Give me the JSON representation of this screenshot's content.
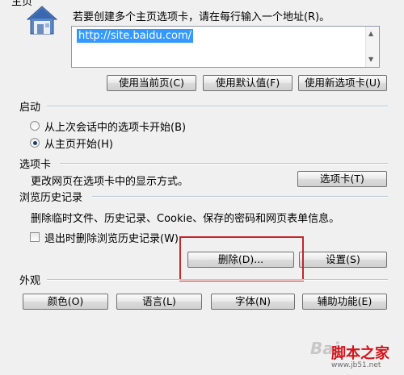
{
  "homepage": {
    "section_title": "主页",
    "instruction": "若要创建多个主页选项卡，请在每行输入一个地址(R)。",
    "url_value": "http://site.baidu.com/",
    "use_current_label": "使用当前页(C)",
    "use_default_label": "使用默认值(F)",
    "use_new_tab_label": "使用新选项卡(U)"
  },
  "startup": {
    "section_title": "启动",
    "option_last_session": "从上次会话中的选项卡开始(B)",
    "option_homepage": "从主页开始(H)",
    "selected": "option_homepage"
  },
  "tabs": {
    "section_title": "选项卡",
    "description": "更改网页在选项卡中的显示方式。",
    "tabs_button_label": "选项卡(T)"
  },
  "history": {
    "section_title": "浏览历史记录",
    "description": "删除临时文件、历史记录、Cookie、保存的密码和网页表单信息。",
    "delete_on_exit_label": "退出时删除浏览历史记录(W)",
    "delete_on_exit_checked": false,
    "delete_button_label": "删除(D)...",
    "settings_button_label": "设置(S)"
  },
  "appearance": {
    "section_title": "外观",
    "colors_label": "颜色(O)",
    "languages_label": "语言(L)",
    "fonts_label": "字体(N)",
    "accessibility_label": "辅助功能(E)"
  },
  "watermark": {
    "logo_text": "Bai",
    "site_name": "脚本之家",
    "site_url": "www.jb51.net"
  },
  "icons": {
    "home": "house-icon"
  },
  "colors": {
    "highlight": "#c0282c",
    "selection": "#3399ff"
  }
}
